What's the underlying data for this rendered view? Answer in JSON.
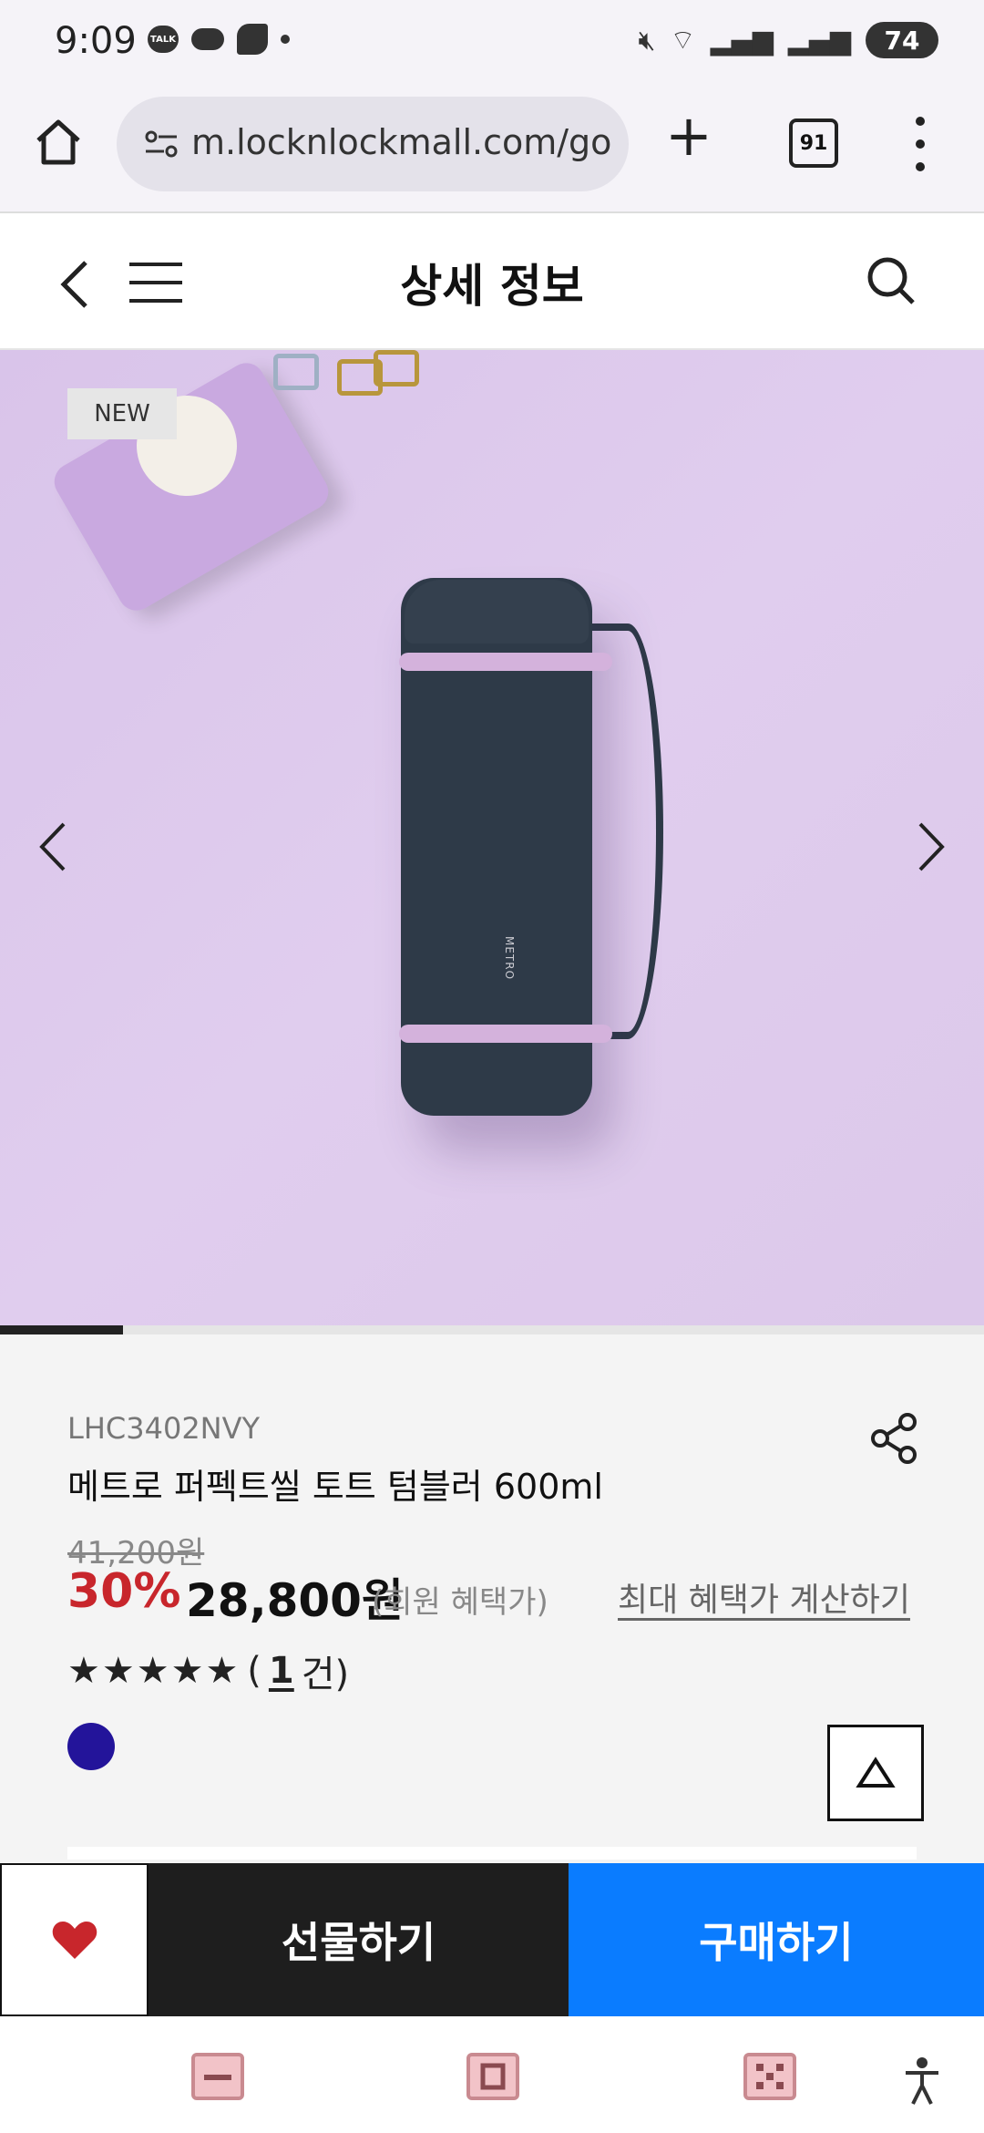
{
  "status_bar": {
    "time": "9:09",
    "battery": "74"
  },
  "browser": {
    "url": "m.locknlockmall.com/go",
    "tab_count": "91"
  },
  "header": {
    "title": "상세 정보"
  },
  "gallery": {
    "badge": "NEW",
    "bottle_print": "METRO",
    "slide_progress": 0.125
  },
  "product": {
    "sku": "LHC3402NVY",
    "name": "메트로 퍼펙트씰 토트 텀블러 600ml",
    "original_price": "41,200원",
    "discount": "30%",
    "price": "28,800원",
    "price_note": "(회원 혜택가)",
    "benefit_link": "최대 혜택가 계산하기",
    "stars": "★★★★★",
    "review_open": "(",
    "review_count": "1",
    "review_suffix": " 건)",
    "color_swatch": "#23149a"
  },
  "actions": {
    "gift": "선물하기",
    "buy": "구매하기"
  },
  "colors": {
    "accent_blue": "#0a7cff",
    "discount_red": "#c8262c",
    "dark": "#1e1e1e"
  }
}
